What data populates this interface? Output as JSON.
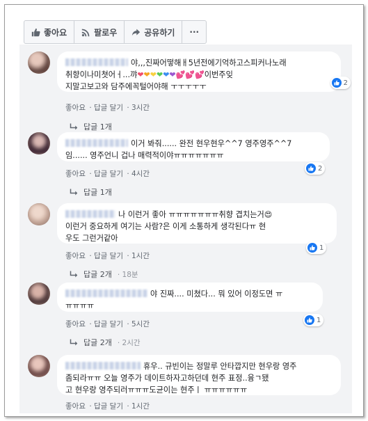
{
  "toolbar": {
    "like_label": "좋아요",
    "follow_label": "팔로우",
    "share_label": "공유하기",
    "more_label": "···"
  },
  "comments": [
    {
      "text_line1": "야,,,진짜어떻해ㅐ5년전에기억하고스피커나노래",
      "text_line2": "취향이나미쳣어ㅓ...꺄",
      "text_line2b": "이번주잊",
      "text_line3": "지말고보고와 담주에꼭털어야해 ㅜㅜㅜㅜㅜ",
      "like": "좋아요",
      "reply": "답글 달기",
      "time": "3시간",
      "reaction_count": "2",
      "replies": "답글 1개",
      "reply_time": ""
    },
    {
      "text_line1": "이거 봐줘...... 완전 현우현우^^7 영주영주^^7",
      "text_line2": "임...... 영주언니 겁나 매력적이야ㅠㅠㅠㅠㅠㅠㅠ",
      "like": "좋아요",
      "reply": "답글 달기",
      "time": "4시간",
      "reaction_count": "2",
      "replies": "답글 1개",
      "reply_time": ""
    },
    {
      "text_line1": "나 이런거 좋아 ㅠㅠㅠㅠㅠㅠㅠ취향 겹치는거",
      "text_line2": "이런거 중요하게 여기는 사람?은 이게 소통하게 생각된다ㅠ 현",
      "text_line3": "우도 그런거같아",
      "like": "좋아요",
      "reply": "답글 달기",
      "time": "1시간",
      "reaction_count": "1",
      "replies": "답글 2개",
      "reply_time": "18분"
    },
    {
      "text_line1": "야 진짜.... 미쳤다... 뭐 있어 이정도면 ㅠ",
      "text_line2": "ㅠㅠㅠㅠ",
      "like": "좋아요",
      "reply": "답글 달기",
      "time": "5시간",
      "reaction_count": "1",
      "replies": "답글 2개",
      "reply_time": "2시간"
    },
    {
      "text_line1": "휴우.. 규빈이는 정말루 안타깝지만 현우랑 영주",
      "text_line2": "좀되라ㅠㅠ 오늘 영주가 데이트하자고하던데 현주 표정..융ㄱ됐",
      "text_line3": "고 현우랑 영주되러ㅠㅠㅠ도균이는 현주ㅣ ㅠㅠㅠㅠㅠㅠ",
      "like": "좋아요",
      "reply": "답글 달기",
      "time": "1시간",
      "reaction_count": "",
      "replies": "",
      "reply_time": ""
    }
  ],
  "colors": {
    "like_blue": "#1877f2",
    "bubble": "#ffffff",
    "feed_bg": "#f2f3f5"
  }
}
